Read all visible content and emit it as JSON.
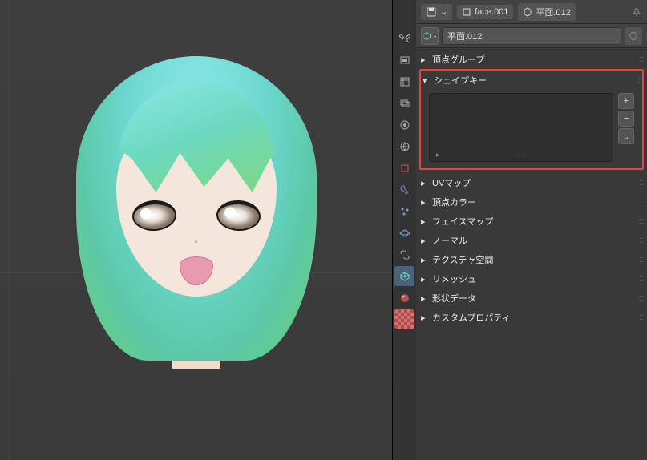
{
  "header": {
    "object_name": "face.001",
    "data_name": "平面.012"
  },
  "mesh_name": "平面.012",
  "panels": {
    "vertex_groups": "頂点グループ",
    "shape_keys": "シェイプキー",
    "uv_maps": "UVマップ",
    "vertex_colors": "頂点カラー",
    "face_maps": "フェイスマップ",
    "normals": "ノーマル",
    "texture_space": "テクスチャ空間",
    "remesh": "リメッシュ",
    "geometry_data": "形状データ",
    "custom_props": "カスタムプロパティ"
  },
  "buttons": {
    "add": "+",
    "remove": "−",
    "specials": "⌄"
  },
  "list": {
    "footer": "▸",
    "dots": "::::"
  }
}
